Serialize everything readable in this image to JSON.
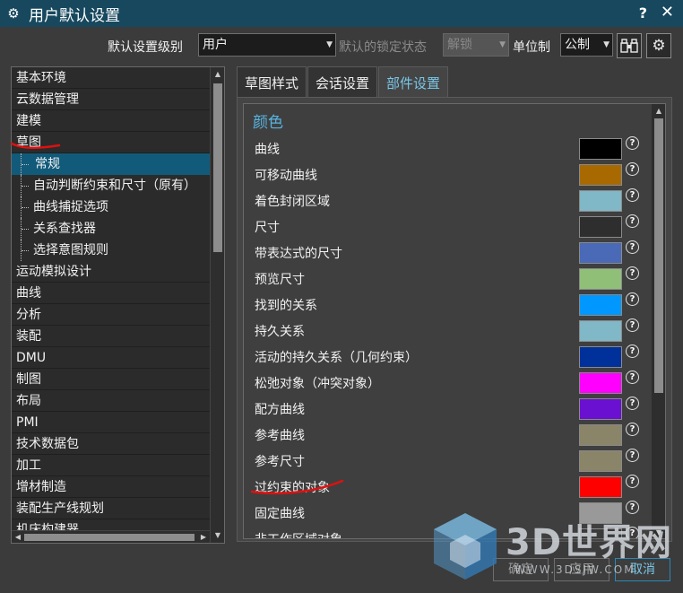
{
  "window": {
    "title": "用户默认设置",
    "help_symbol": "?",
    "close_symbol": "✕",
    "icon": "gear-icon"
  },
  "toolbar": {
    "level_label": "默认设置级别",
    "level_value": "用户",
    "lock_label": "默认的锁定状态",
    "lock_value": "解锁",
    "unit_label": "单位制",
    "unit_value": "公制",
    "find_icon": "binoculars-icon",
    "settings_icon": "gear-icon"
  },
  "tree": {
    "items": [
      {
        "label": "基本环境"
      },
      {
        "label": "云数据管理"
      },
      {
        "label": "建模"
      },
      {
        "label": "草图"
      },
      {
        "label": "常规",
        "child": true,
        "selected": true
      },
      {
        "label": "自动判断约束和尺寸（原有）",
        "child": true
      },
      {
        "label": "曲线捕捉选项",
        "child": true
      },
      {
        "label": "关系查找器",
        "child": true
      },
      {
        "label": "选择意图规则",
        "child": true
      },
      {
        "label": "运动模拟设计"
      },
      {
        "label": "曲线"
      },
      {
        "label": "分析"
      },
      {
        "label": "装配"
      },
      {
        "label": "DMU"
      },
      {
        "label": "制图"
      },
      {
        "label": "布局"
      },
      {
        "label": "PMI"
      },
      {
        "label": "技术数据包"
      },
      {
        "label": "加工"
      },
      {
        "label": "增材制造"
      },
      {
        "label": "装配生产线规划"
      },
      {
        "label": "机床构建器"
      }
    ]
  },
  "tabs": [
    {
      "label": "草图样式"
    },
    {
      "label": "会话设置"
    },
    {
      "label": "部件设置",
      "active": true
    }
  ],
  "colors_section": {
    "title": "颜色",
    "help_symbol": "?",
    "rows": [
      {
        "label": "曲线",
        "color": "#000000"
      },
      {
        "label": "可移动曲线",
        "color": "#a86a00"
      },
      {
        "label": "着色封闭区域",
        "color": "#80b8c8"
      },
      {
        "label": "尺寸",
        "color": "#2e2e2e"
      },
      {
        "label": "带表达式的尺寸",
        "color": "#4a6ab8"
      },
      {
        "label": "预览尺寸",
        "color": "#90c078"
      },
      {
        "label": "找到的关系",
        "color": "#0098ff"
      },
      {
        "label": "持久关系",
        "color": "#80b8c8"
      },
      {
        "label": "活动的持久关系（几何约束）",
        "color": "#00309a"
      },
      {
        "label": "松弛对象（冲突对象）",
        "color": "#ff00ff"
      },
      {
        "label": "配方曲线",
        "color": "#6a10d0"
      },
      {
        "label": "参考曲线",
        "color": "#8a8468"
      },
      {
        "label": "参考尺寸",
        "color": "#8a8468"
      },
      {
        "label": "过约束的对象",
        "color": "#ff0000"
      },
      {
        "label": "固定曲线",
        "color": "#999999"
      },
      {
        "label": "非工作区域对象",
        "color": "#3a3a3a"
      }
    ]
  },
  "buttons": {
    "ok": "确定",
    "apply": "应用",
    "cancel": "取消"
  },
  "watermark": {
    "text": "3D世界网",
    "url": "WWW.3DSJW.COM"
  },
  "theme": {
    "accent": "#58b4e0",
    "titlebar": "#17485e",
    "annotation": "#e01010"
  }
}
